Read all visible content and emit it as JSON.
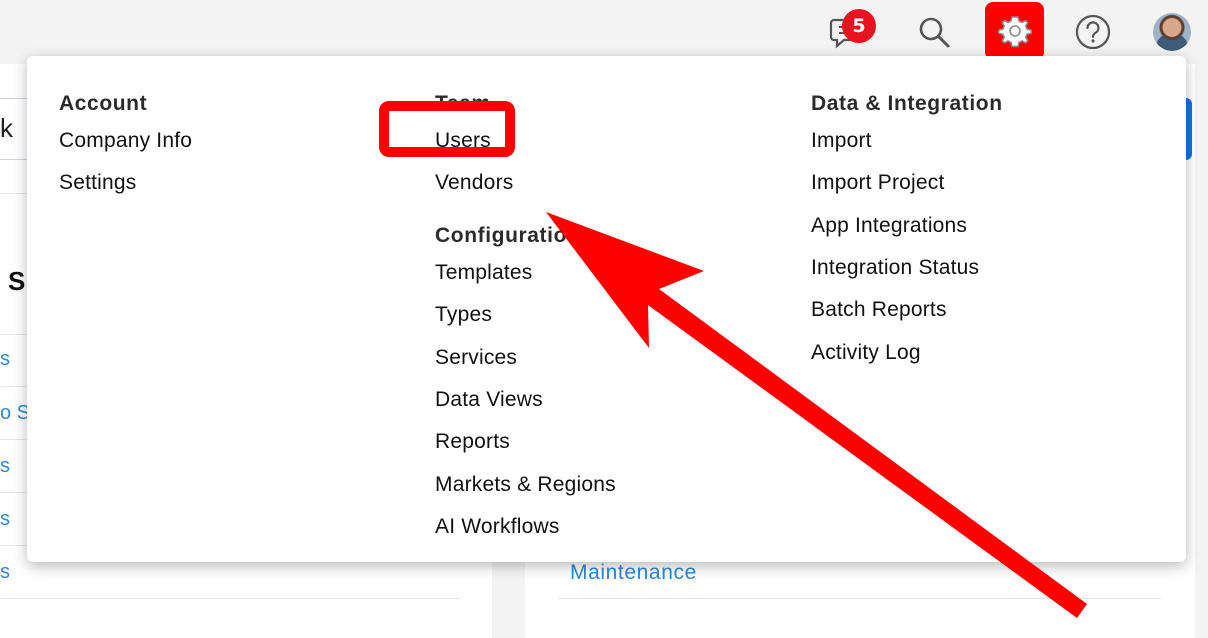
{
  "topbar": {
    "notification_count": "5",
    "icons": [
      "chat-icon",
      "search-icon",
      "gear-icon",
      "help-icon",
      "avatar"
    ]
  },
  "background": {
    "input_fragment": "k",
    "heading_fragment": "Si",
    "link_fragments": [
      "s",
      "o S",
      "s",
      "s",
      "s"
    ],
    "right_link": "Maintenance"
  },
  "menu": {
    "account": {
      "heading": "Account",
      "items": [
        "Company Info",
        "Settings"
      ]
    },
    "team": {
      "heading": "Team",
      "items": [
        "Users",
        "Vendors"
      ]
    },
    "configuration": {
      "heading": "Configuratio",
      "items": [
        "Templates",
        "Types",
        "Services",
        "Data Views",
        "Reports",
        "Markets & Regions",
        "AI Workflows"
      ]
    },
    "data_integration": {
      "heading": "Data & Integration",
      "items": [
        "Import",
        "Import Project",
        "App Integrations",
        "Integration Status",
        "Batch Reports",
        "Activity Log"
      ]
    }
  },
  "colors": {
    "highlight": "#ff0000",
    "badge": "#e8131f",
    "link": "#2d88d8"
  }
}
